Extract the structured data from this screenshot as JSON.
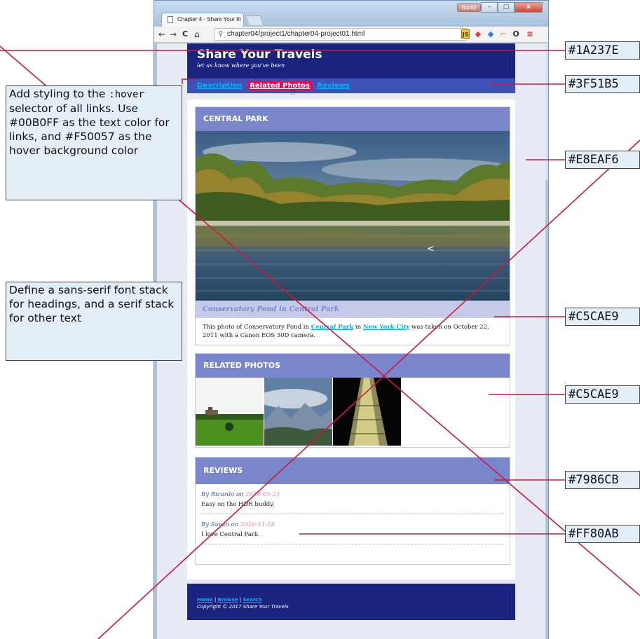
{
  "browser": {
    "tab_title": "Chapter 4 - Share Your Tr",
    "tab_close": "×",
    "user_button": "Randy",
    "minimize": "–",
    "maximize": "□",
    "close": "x",
    "back": "←",
    "forward": "→",
    "reload": "C",
    "home": "⌂",
    "url": "chapter04/project1/chapter04-project01.html",
    "menu": "≡"
  },
  "site": {
    "title": "Share Your Travels",
    "tagline": "let us know where you've been",
    "nav": [
      "Description",
      "Related Photos",
      "Reviews"
    ],
    "nav_hover_index": 1
  },
  "photo_card": {
    "heading": "CENTRAL PARK",
    "caption": "Conservatory Pond in Central Park",
    "desc_pre": "This photo of Conservatory Pond in ",
    "link1": "Central Park",
    "desc_mid": " in ",
    "link2": "New York City",
    "desc_post": " was taken on October 22, 2011 with a Canon EOS 30D camera."
  },
  "related": {
    "heading": "RELATED PHOTOS"
  },
  "reviews": {
    "heading": "REVIEWS",
    "items": [
      {
        "by": "By Ricardo on ",
        "date": "2016-05-23",
        "text": "Easy on the HDR buddy."
      },
      {
        "by": "By Susan on ",
        "date": "2016-11-18",
        "text": "I love Central Park."
      }
    ]
  },
  "footer": {
    "links": [
      "Home",
      "Browse",
      "Search"
    ],
    "separator": " | ",
    "copyright": "Copyright © 2017 Share Your Travels"
  },
  "annotations": {
    "hover_note_pre": "Add styling to the ",
    "hover_note_code": ":hover",
    "hover_note_post": " selector of all links. Use #00B0FF as the text color for links, and #F50057 as the hover background color",
    "font_note": "Define a sans-serif font stack for headings, and a serif stack for other text",
    "swatches": [
      "#1A237E",
      "#3F51B5",
      "#E8EAF6",
      "#C5CAE9",
      "#C5CAE9",
      "#7986CB",
      "#FF80AB"
    ]
  },
  "colors": {
    "header_bg": "#1A237E",
    "nav_bg": "#3F51B5",
    "page_bg": "#E8EAF6",
    "caption_bg": "#C5CAE9",
    "card_head_bg": "#7986CB",
    "date_color": "#FF80AB",
    "link_color": "#00B0FF",
    "hover_bg": "#F50057",
    "annotation_line": "#D0163A"
  }
}
